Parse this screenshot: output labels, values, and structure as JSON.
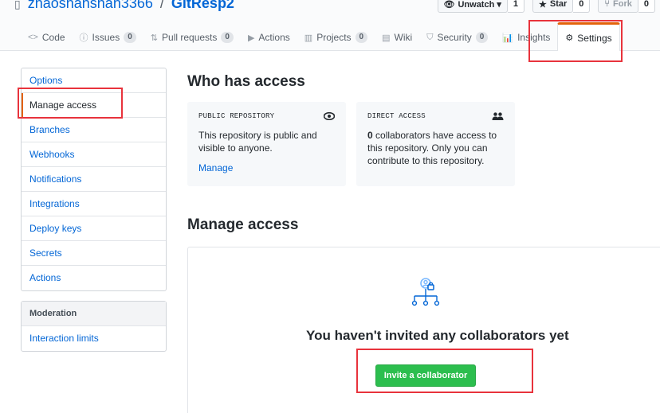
{
  "repo": {
    "owner": "zhaoshanshan3366",
    "separator": "/",
    "name": "GitResp2"
  },
  "repo_actions": {
    "unwatch_label": "Unwatch ▾",
    "unwatch_count": "1",
    "star_label": "Star",
    "star_count": "0",
    "fork_label": "Fork",
    "fork_count": "0"
  },
  "tabs": [
    {
      "label": "Code",
      "icon": "<>"
    },
    {
      "label": "Issues",
      "count": "0"
    },
    {
      "label": "Pull requests",
      "count": "0"
    },
    {
      "label": "Actions"
    },
    {
      "label": "Projects",
      "count": "0"
    },
    {
      "label": "Wiki"
    },
    {
      "label": "Security",
      "count": "0"
    },
    {
      "label": "Insights"
    },
    {
      "label": "Settings"
    }
  ],
  "sidebar": {
    "items": [
      "Options",
      "Manage access",
      "Branches",
      "Webhooks",
      "Notifications",
      "Integrations",
      "Deploy keys",
      "Secrets",
      "Actions"
    ],
    "moderation_heading": "Moderation",
    "moderation_items": [
      "Interaction limits"
    ]
  },
  "main": {
    "who_has_access": "Who has access",
    "public_card": {
      "label": "PUBLIC REPOSITORY",
      "text": "This repository is public and visible to anyone.",
      "link": "Manage"
    },
    "direct_card": {
      "label": "DIRECT ACCESS",
      "count": "0",
      "text": " collaborators have access to this repository. Only you can contribute to this repository."
    },
    "manage_access": "Manage access",
    "empty_title": "You haven't invited any collaborators yet",
    "invite_button": "Invite a collaborator"
  },
  "colors": {
    "accent": "#e36209",
    "link": "#0366d6",
    "primary_button": "#2cbe4e",
    "annotation": "#e8333c"
  }
}
